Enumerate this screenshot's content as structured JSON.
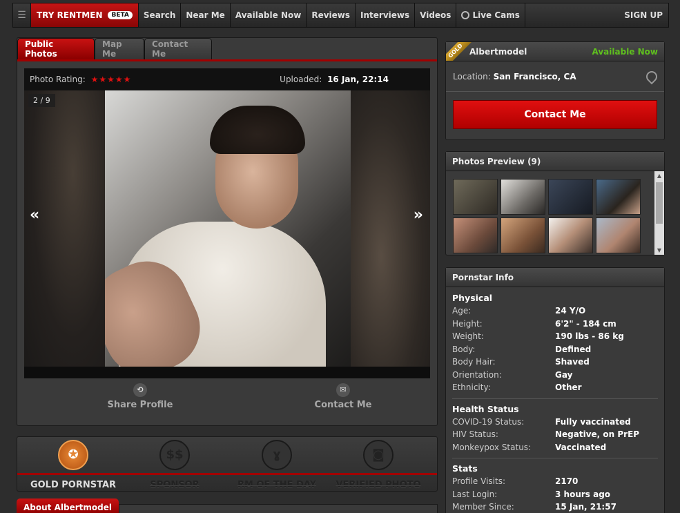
{
  "nav": {
    "brand": "TRY RENTMEN",
    "beta": "BETA",
    "items": [
      "Search",
      "Near Me",
      "Available Now",
      "Reviews",
      "Interviews",
      "Videos",
      "Live Cams"
    ],
    "signup": "SIGN UP"
  },
  "tabs": [
    "Public Photos",
    "Map Me",
    "Contact Me"
  ],
  "photo": {
    "rating_label": "Photo Rating:",
    "stars": "★★★★★",
    "uploaded_label": "Uploaded:",
    "uploaded_date": "16 Jan, 22:14",
    "counter": "2 / 9",
    "prev": "«",
    "next": "»"
  },
  "actions": {
    "share": "Share Profile",
    "contact": "Contact Me"
  },
  "badges": [
    "GOLD PORNSTAR",
    "SPONSOR",
    "RM OF THE DAY",
    "VERIFIED PHOTO"
  ],
  "about_tab": "About Albertmodel",
  "profile": {
    "ribbon": "GOLD",
    "name": "Albertmodel",
    "status": "Available Now",
    "location_label": "Location:",
    "location": "San Francisco, CA",
    "contact_button": "Contact Me"
  },
  "preview": {
    "title": "Photos Preview (9)"
  },
  "info": {
    "title": "Pornstar Info",
    "physical_title": "Physical",
    "physical": [
      {
        "k": "Age:",
        "v": "24 Y/O"
      },
      {
        "k": "Height:",
        "v": "6'2\" - 184 cm"
      },
      {
        "k": "Weight:",
        "v": "190 lbs - 86 kg"
      },
      {
        "k": "Body:",
        "v": "Defined"
      },
      {
        "k": "Body Hair:",
        "v": "Shaved"
      },
      {
        "k": "Orientation:",
        "v": "Gay"
      },
      {
        "k": "Ethnicity:",
        "v": "Other"
      }
    ],
    "health_title": "Health Status",
    "health": [
      {
        "k": "COVID-19 Status:",
        "v": "Fully vaccinated"
      },
      {
        "k": "HIV Status:",
        "v": "Negative, on PrEP"
      },
      {
        "k": "Monkeypox Status:",
        "v": "Vaccinated"
      }
    ],
    "stats_title": "Stats",
    "stats": [
      {
        "k": "Profile Visits:",
        "v": "2170"
      },
      {
        "k": "Last Login:",
        "v": "3 hours ago"
      },
      {
        "k": "Member Since:",
        "v": "15 Jan, 21:57"
      }
    ]
  },
  "colors": {
    "accent_red": "#c81212",
    "available_green": "#5fbf1e",
    "gold": "#d9a72f"
  }
}
